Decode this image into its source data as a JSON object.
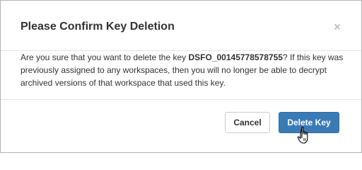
{
  "dialog": {
    "title": "Please Confirm Key Deletion",
    "close_label": "×",
    "message_prefix": "Are you sure that you want to delete the key ",
    "key_name": "DSFO_00145778578755",
    "message_suffix": "? If this key was previously assigned to any workspaces, then you will no longer be able to decrypt archived versions of that workspace that used this key.",
    "cancel_label": "Cancel",
    "delete_label": "Delete Key"
  },
  "colors": {
    "primary": "#3a7bb6",
    "text": "#333333",
    "close": "#bdbdbd"
  },
  "icons": {
    "close": "close-icon",
    "cursor": "hand-pointer-icon"
  }
}
